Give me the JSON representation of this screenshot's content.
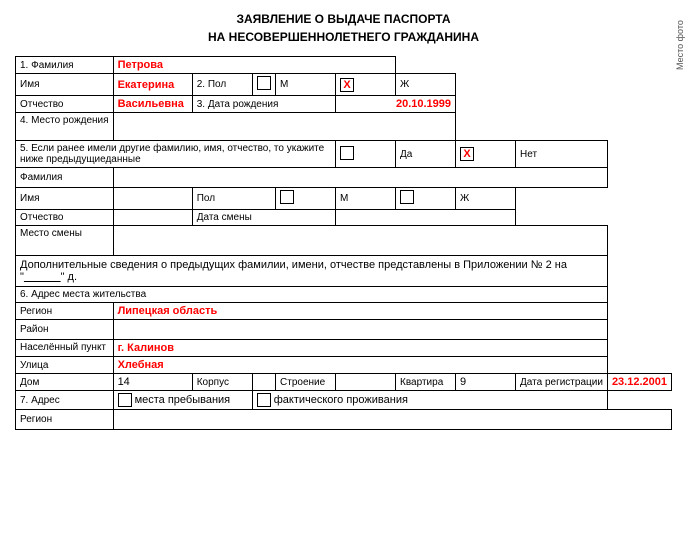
{
  "title": {
    "line1": "ЗАЯВЛЕНИЕ О ВЫДАЧЕ ПАСПОРТА",
    "line2": "НА НЕСОВЕРШЕННОЛЕТНЕГО ГРАЖДАНИНА"
  },
  "sideText": "Место фото",
  "fields": {
    "familiya_label": "1. Фамилия",
    "familiya_value": "Петрова",
    "imya_label": "Имя",
    "imya_value": "Екатерина",
    "pol_label": "2. Пол",
    "pol_m": "М",
    "pol_zh": "Ж",
    "otchestvo_label": "Отчество",
    "otchestvo_value": "Васильевна",
    "data_rozhdeniya_label": "3. Дата рождения",
    "data_rozhdeniya_value": "20.10.1999",
    "mesto_rozhdeniya_label": "4. Место рождения",
    "earlier_label": "5. Если ранее имели другие фамилию, имя, отчество, то укажите ниже предыдущиеданные",
    "da_label": "Да",
    "net_label": "Нет",
    "familiya2_label": "Фамилия",
    "imya2_label": "Имя",
    "otchestvo2_label": "Отчество",
    "pol2_label": "Пол",
    "pol2_m": "М",
    "pol2_zh": "Ж",
    "data_smeny_label": "Дата смены",
    "mesto_smeny_label": "Место смены",
    "additional_text": "Дополнительные сведения о предыдущих фамилии, имени, отчестве представлены в Приложении № 2 на \"",
    "additional_text2": "\" д.",
    "adres_label": "6. Адрес места жительства",
    "region_label": "Регион",
    "region_value": "Липецкая область",
    "rayon_label": "Район",
    "nasel_punkt_label": "Населённый пункт",
    "nasel_punkt_value": "г. Калинов",
    "ulitsa_label": "Улица",
    "ulitsa_value": "Хлебная",
    "dom_label": "Дом",
    "dom_value": "14",
    "korpus_label": "Корпус",
    "stroenie_label": "Строение",
    "kvartira_label": "Квартира",
    "kvartira_value": "9",
    "data_reg_label": "Дата регистрации",
    "data_reg_value": "23.12.2001",
    "adres7_label": "7. Адрес",
    "mesta_prebyvaniya_label": "места пребывания",
    "fakticheskogo_label": "фактического проживания",
    "region2_label": "Регион"
  }
}
